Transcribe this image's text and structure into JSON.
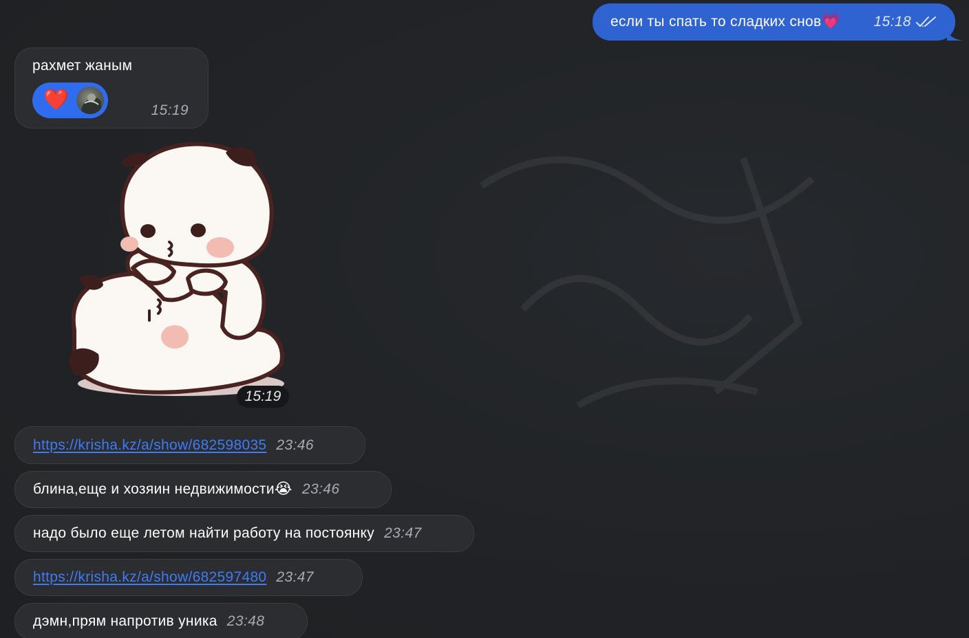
{
  "messages": [
    {
      "id": "out-1",
      "direction": "out",
      "text": "если ты спать то сладких снов",
      "emoji": "💗",
      "time": "15:18",
      "status": "read"
    },
    {
      "id": "in-1",
      "direction": "in",
      "text": "рахмет жаным",
      "time": "15:19",
      "reaction": {
        "emoji": "❤️"
      }
    },
    {
      "id": "in-sticker",
      "direction": "in",
      "type": "sticker",
      "sticker_icon": "panda-sticker",
      "time": "15:19"
    },
    {
      "id": "in-2",
      "direction": "in",
      "link": "https://krisha.kz/a/show/682598035",
      "time": "23:46"
    },
    {
      "id": "in-3",
      "direction": "in",
      "text": "блина,еще и хозяин недвижимости",
      "emoji": "😭",
      "time": "23:46"
    },
    {
      "id": "in-4",
      "direction": "in",
      "text": "надо было еще летом найти работу на постоянку",
      "time": "23:47"
    },
    {
      "id": "in-5",
      "direction": "in",
      "link": "https://krisha.kz/a/show/682597480",
      "time": "23:47"
    },
    {
      "id": "in-6",
      "direction": "in",
      "text": "дэмн,прям напротив уника",
      "time": "23:48"
    }
  ],
  "colors": {
    "background": "#212326",
    "incoming_bubble": "#2b2d30",
    "outgoing_bubble": "#2f63d2",
    "link": "#3e7cf5",
    "reaction_pill": "#2f6cf0"
  }
}
